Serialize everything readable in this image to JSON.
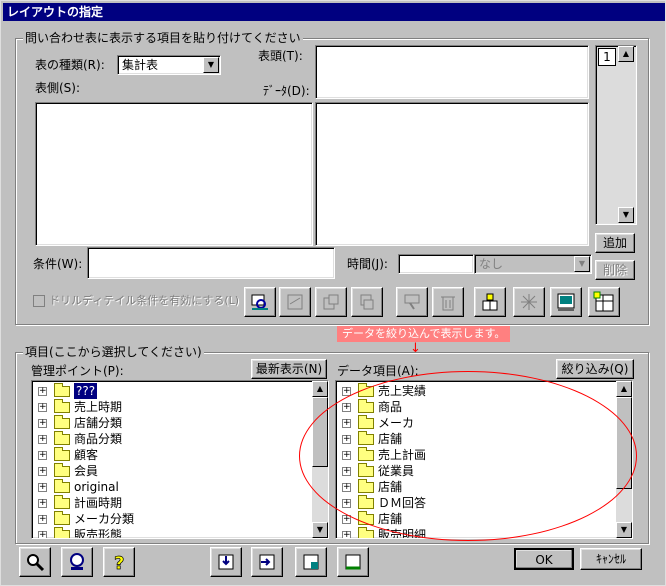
{
  "window": {
    "title": "レイアウトの指定"
  },
  "top_group": {
    "label": "問い合わせ表に表示する項目を貼り付けてください",
    "table_type_label": "表の種類(R):",
    "table_type_value": "集計表",
    "header_label": "表頭(T):",
    "side_label": "表側(S):",
    "data_label": "ﾃﾞｰﾀ(D):",
    "page_value": "1",
    "condition_label": "条件(W):",
    "time_label": "時間(J):",
    "time_select_value": "なし",
    "add_button": "追加",
    "delete_button": "削除",
    "drill_checkbox_label": "ドリルディテイル条件を有効にする(L)"
  },
  "callout": {
    "text": "データを絞り込んで表示します。",
    "arrow": "↓"
  },
  "items_group": {
    "label": "項目(ここから選択してください)",
    "mgmt_point_label": "管理ポイント(P):",
    "refresh_button": "最新表示(N)",
    "data_items_label": "データ項目(A):",
    "filter_button": "絞り込み(Q)",
    "left_tree": [
      "???",
      "売上時期",
      "店舗分類",
      "商品分類",
      "顧客",
      "会員",
      "original",
      "計画時期",
      "メーカ分類",
      "販売形態"
    ],
    "right_tree": [
      "売上実績",
      "商品",
      "メーカ",
      "店舗",
      "売上計画",
      "従業員",
      "店舗",
      "ＤＭ回答",
      "店舗",
      "販売明細"
    ]
  },
  "footer": {
    "ok_button": "OK",
    "cancel_button": "ｷｬﾝｾﾙ"
  },
  "colors": {
    "title_bar": "#000080",
    "face": "#c0c0c0",
    "callout": "#ff8080",
    "ellipse": "#ff0000"
  }
}
